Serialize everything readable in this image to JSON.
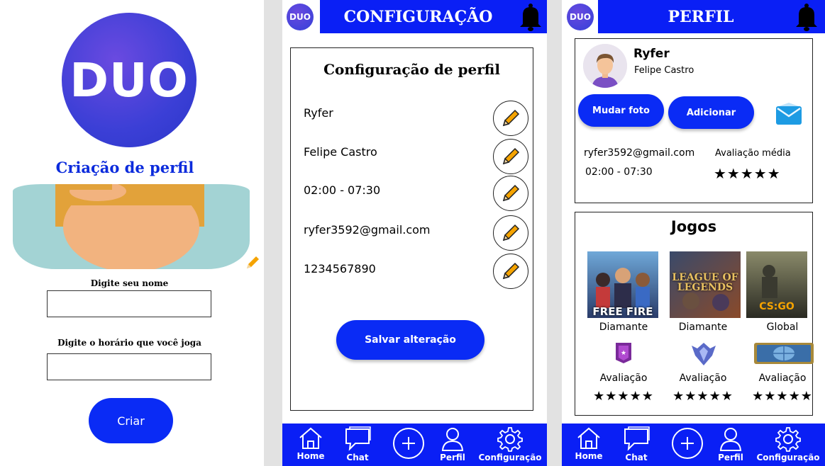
{
  "colors": {
    "brand_blue": "#0a1ff5",
    "button_blue": "#0a2bf5",
    "title_blue": "#0b2bdc",
    "pencil_orange": "#f5a300"
  },
  "logo": {
    "text": "DUO"
  },
  "create_profile": {
    "title": "Criação de perfil",
    "name_label": "Digite seu nome",
    "name_value": "",
    "schedule_label": "Digite o horário que você joga",
    "schedule_value": "",
    "create_button": "Criar"
  },
  "settings_screen": {
    "header_title": "CONFIGURAÇÃO",
    "card_title": "Configuração de perfil",
    "fields": [
      {
        "value": "Ryfer",
        "icon": "pencil-icon"
      },
      {
        "value": "Felipe Castro",
        "icon": "pencil-icon"
      },
      {
        "value": "02:00 - 07:30",
        "icon": "pencil-icon"
      },
      {
        "value": "ryfer3592@gmail.com",
        "icon": "pencil-icon"
      },
      {
        "value": "1234567890",
        "icon": "pencil-icon"
      }
    ],
    "save_button": "Salvar alteração"
  },
  "profile_screen": {
    "header_title": "PERFIL",
    "nickname": "Ryfer",
    "full_name": "Felipe Castro",
    "change_photo_button": "Mudar foto",
    "add_button": "Adicionar",
    "email": "ryfer3592@gmail.com",
    "hours": "02:00 - 07:30",
    "rating_label": "Avaliação média",
    "rating_stars": "★★★★★",
    "rating_value": 5,
    "games_title": "Jogos",
    "games": [
      {
        "cover_text": "FREE FIRE",
        "rank": "Diamante",
        "rank_icon": "diamond-rank-icon",
        "eval_label": "Avaliação",
        "stars": "★★★★★",
        "stars_value": 5
      },
      {
        "cover_text": "LEAGUE OF LEGENDS",
        "rank": "Diamante",
        "rank_icon": "diamond-crest-icon",
        "eval_label": "Avaliação",
        "stars": "★★★★★",
        "stars_value": 5
      },
      {
        "cover_text": "CS:GO",
        "rank": "Global",
        "rank_icon": "global-elite-icon",
        "eval_label": "Avaliação",
        "stars": "★★★★★",
        "stars_value": 5
      }
    ]
  },
  "nav": {
    "home": "Home",
    "chat": "Chat",
    "add": "",
    "profile": "Perfil",
    "settings": "Configuração"
  }
}
